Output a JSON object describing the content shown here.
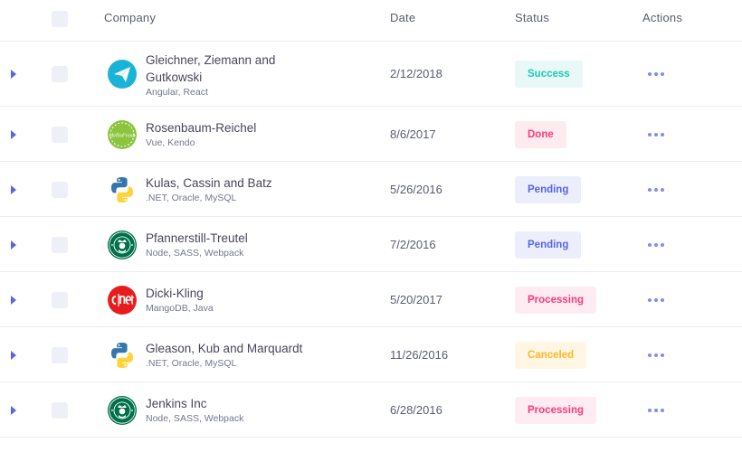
{
  "header": {
    "company": "Company",
    "date": "Date",
    "status": "Status",
    "actions": "Actions"
  },
  "rows": [
    {
      "name_line1": "Gleichner, Ziemann and",
      "name_line2": "Gutkowski",
      "tech": "Angular, React",
      "date": "2/12/2018",
      "status": "Success",
      "logo": "paper-plane-icon"
    },
    {
      "name_line1": "Rosenbaum-Reichel",
      "tech": "Vue, Kendo",
      "date": "8/6/2017",
      "status": "Done",
      "logo": "hellofresh-logo",
      "logo_text": "HelloFresh"
    },
    {
      "name_line1": "Kulas, Cassin and Batz",
      "tech": ".NET, Oracle, MySQL",
      "date": "5/26/2016",
      "status": "Pending",
      "logo": "python-logo"
    },
    {
      "name_line1": "Pfannerstill-Treutel",
      "tech": "Node, SASS, Webpack",
      "date": "7/2/2016",
      "status": "Pending",
      "logo": "starbucks-logo"
    },
    {
      "name_line1": "Dicki-Kling",
      "tech": "MangoDB, Java",
      "date": "5/20/2017",
      "status": "Processing",
      "logo": "cnet-logo"
    },
    {
      "name_line1": "Gleason, Kub and Marquardt",
      "tech": ".NET, Oracle, MySQL",
      "date": "11/26/2016",
      "status": "Canceled",
      "logo": "python-logo"
    },
    {
      "name_line1": "Jenkins Inc",
      "tech": "Node, SASS, Webpack",
      "date": "6/28/2016",
      "status": "Processing",
      "logo": "starbucks-logo"
    }
  ],
  "status_colors": {
    "Success": {
      "bg": "#e8f8f6",
      "fg": "#1dc9b7"
    },
    "Done": {
      "bg": "#fdecef",
      "fg": "#fd397a"
    },
    "Pending": {
      "bg": "#eceefb",
      "fg": "#5867dd"
    },
    "Processing": {
      "bg": "#fdecf1",
      "fg": "#fd397a"
    },
    "Canceled": {
      "bg": "#fff6e3",
      "fg": "#ffb822"
    }
  },
  "accent": "#5867dd"
}
